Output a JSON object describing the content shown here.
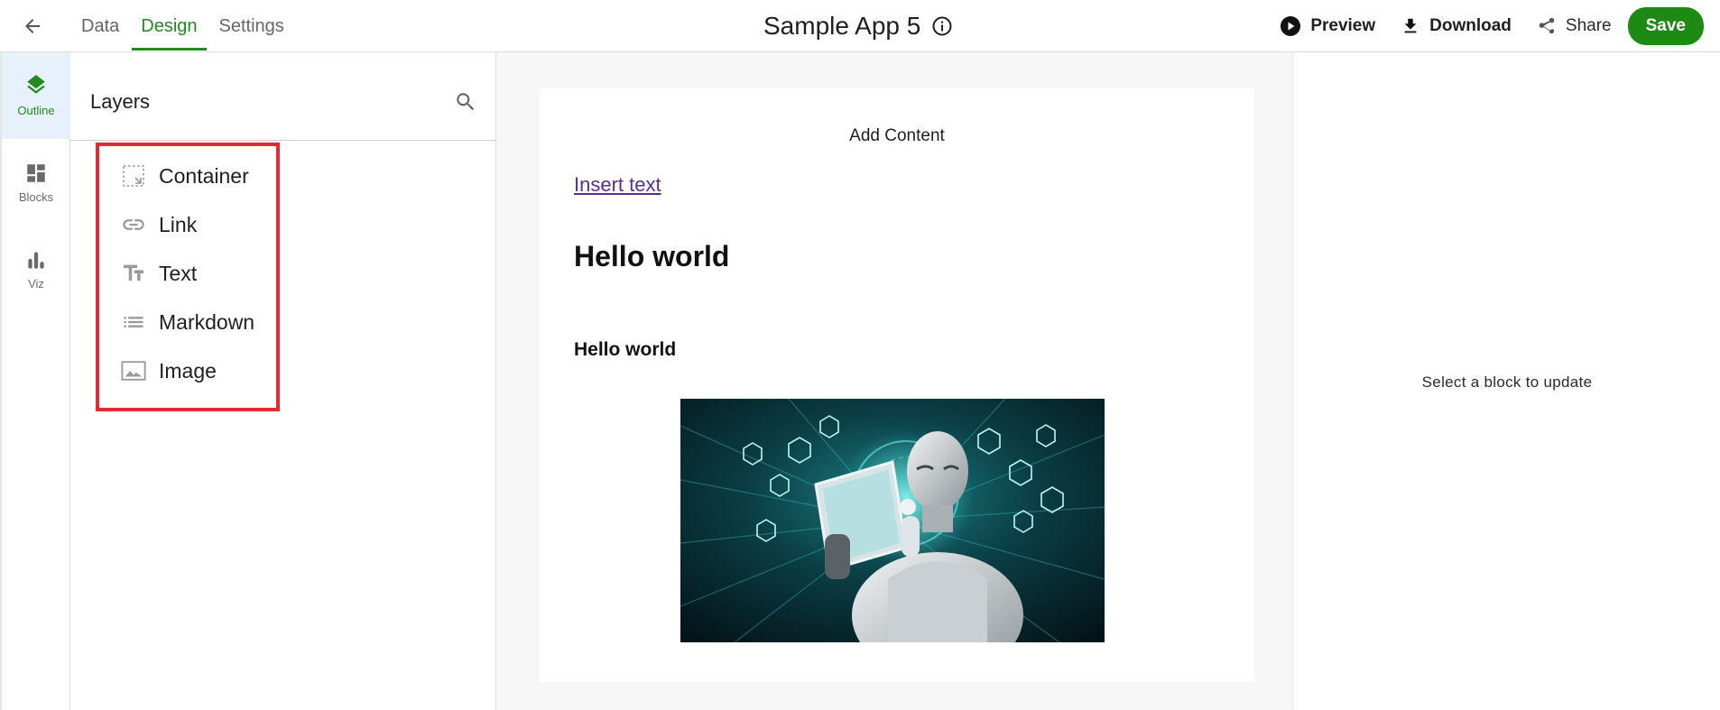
{
  "header": {
    "tabs": [
      {
        "label": "Data"
      },
      {
        "label": "Design"
      },
      {
        "label": "Settings"
      }
    ],
    "app_title": "Sample App 5",
    "actions": {
      "preview": "Preview",
      "download": "Download",
      "share": "Share",
      "save": "Save"
    }
  },
  "rail": {
    "items": [
      {
        "label": "Outline",
        "icon": "layers-icon"
      },
      {
        "label": "Blocks",
        "icon": "dashboard-icon"
      },
      {
        "label": "Viz",
        "icon": "bar-chart-icon"
      }
    ]
  },
  "layers": {
    "title": "Layers",
    "items": [
      {
        "label": "Container",
        "icon": "container-icon"
      },
      {
        "label": "Link",
        "icon": "link-icon"
      },
      {
        "label": "Text",
        "icon": "text-icon"
      },
      {
        "label": "Markdown",
        "icon": "list-icon"
      },
      {
        "label": "Image",
        "icon": "image-icon"
      }
    ]
  },
  "canvas": {
    "add_content": "Add Content",
    "insert_text": "Insert text",
    "heading_large": "Hello world",
    "heading_small": "Hello world"
  },
  "props": {
    "empty_message": "Select a block to update"
  },
  "colors": {
    "accent": "#238a1e",
    "save_button": "#1d8a14",
    "highlight_border": "#e02b35",
    "link": "#5a2d91"
  }
}
